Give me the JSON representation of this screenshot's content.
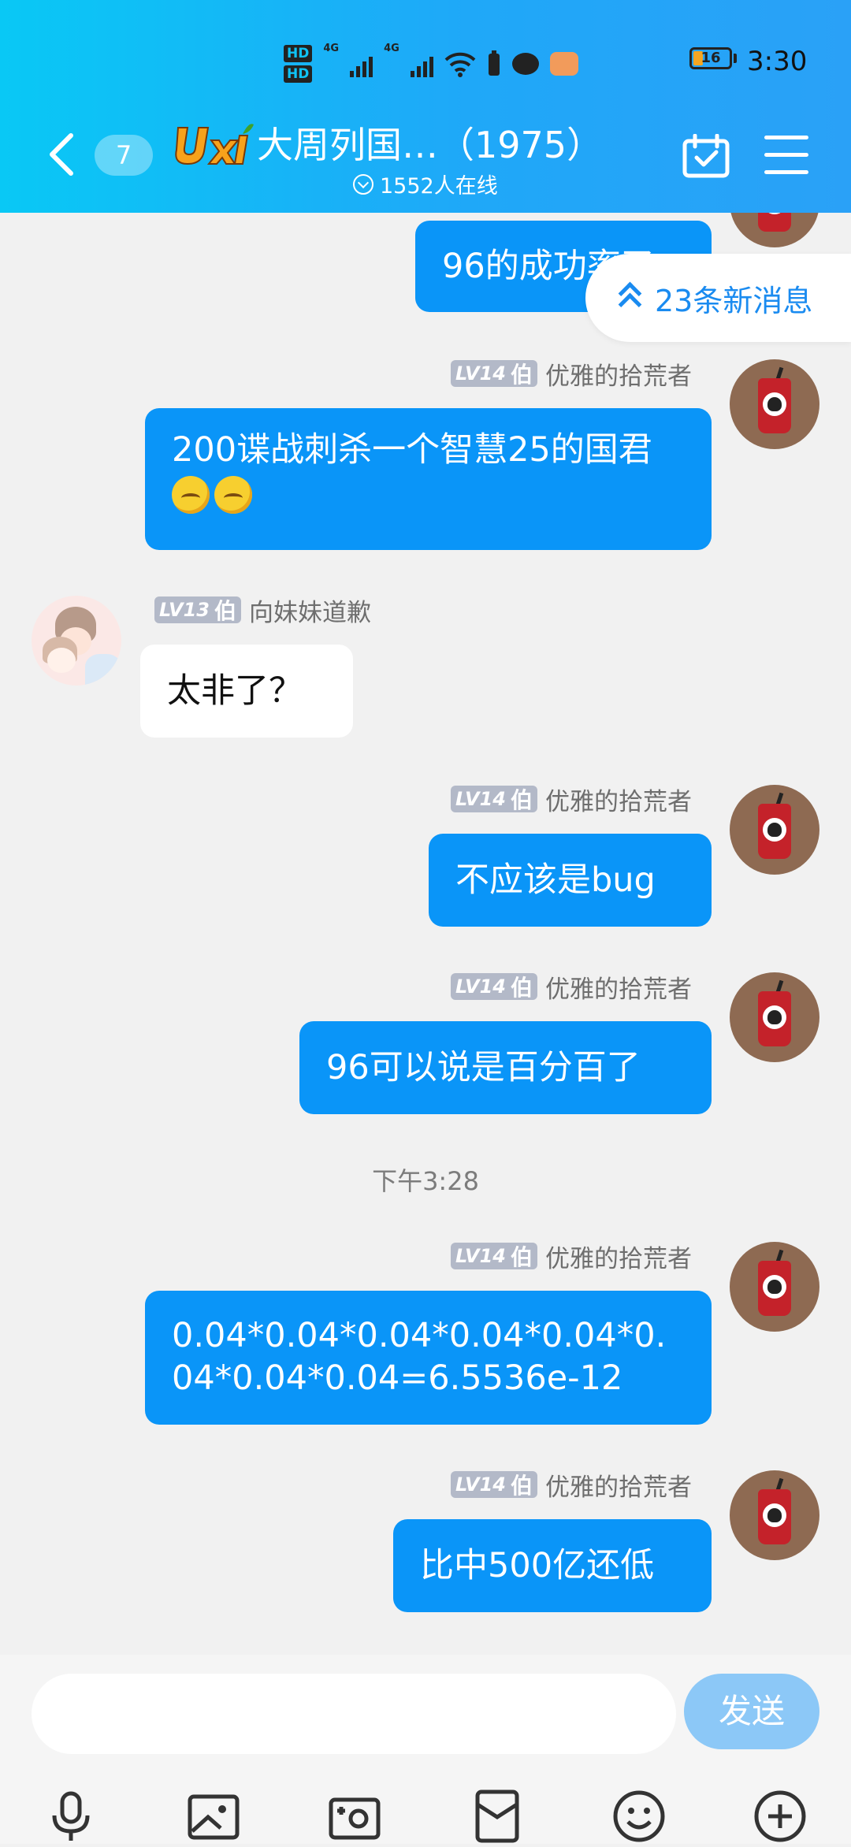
{
  "status_bar": {
    "time": "3:30",
    "battery": "16",
    "hd1": "HD",
    "hd2": "HD",
    "net1": "4G",
    "net2": "4G"
  },
  "header": {
    "unread_count": "7",
    "title": "大周列国…（1975）",
    "online": "1552人在线"
  },
  "new_messages": "23条新消息",
  "messages": [
    {
      "side": "right",
      "text": "96的成功率了"
    },
    {
      "side": "right",
      "level": "LV14",
      "rank": "伯",
      "nick": "优雅的拾荒者",
      "text": "200谍战刺杀一个智慧25的国君"
    },
    {
      "side": "left",
      "level": "LV13",
      "rank": "伯",
      "nick": "向妹妹道歉",
      "text": "太非了？"
    },
    {
      "side": "right",
      "level": "LV14",
      "rank": "伯",
      "nick": "优雅的拾荒者",
      "text": "不应该是bug"
    },
    {
      "side": "right",
      "level": "LV14",
      "rank": "伯",
      "nick": "优雅的拾荒者",
      "text": "96可以说是百分百了"
    },
    {
      "side": "right",
      "level": "LV14",
      "rank": "伯",
      "nick": "优雅的拾荒者",
      "text": "0.04*0.04*0.04*0.04*0.04*0.04*0.04*0.04=6.5536e-12"
    },
    {
      "side": "right",
      "level": "LV14",
      "rank": "伯",
      "nick": "优雅的拾荒者",
      "text": "比中500亿还低"
    }
  ],
  "timestamp": "下午3:28",
  "input": {
    "placeholder": "",
    "send_label": "发送"
  },
  "toolbar": [
    "microphone-icon",
    "image-icon",
    "camera-icon",
    "red-packet-icon",
    "emoji-icon",
    "plus-icon"
  ],
  "colors": {
    "header_start": "#09c8f5",
    "header_end": "#2aa1f7",
    "my_bubble": "#0a95f8",
    "send_button": "#8cc8f7",
    "new_msg_text": "#1a8bf0"
  }
}
